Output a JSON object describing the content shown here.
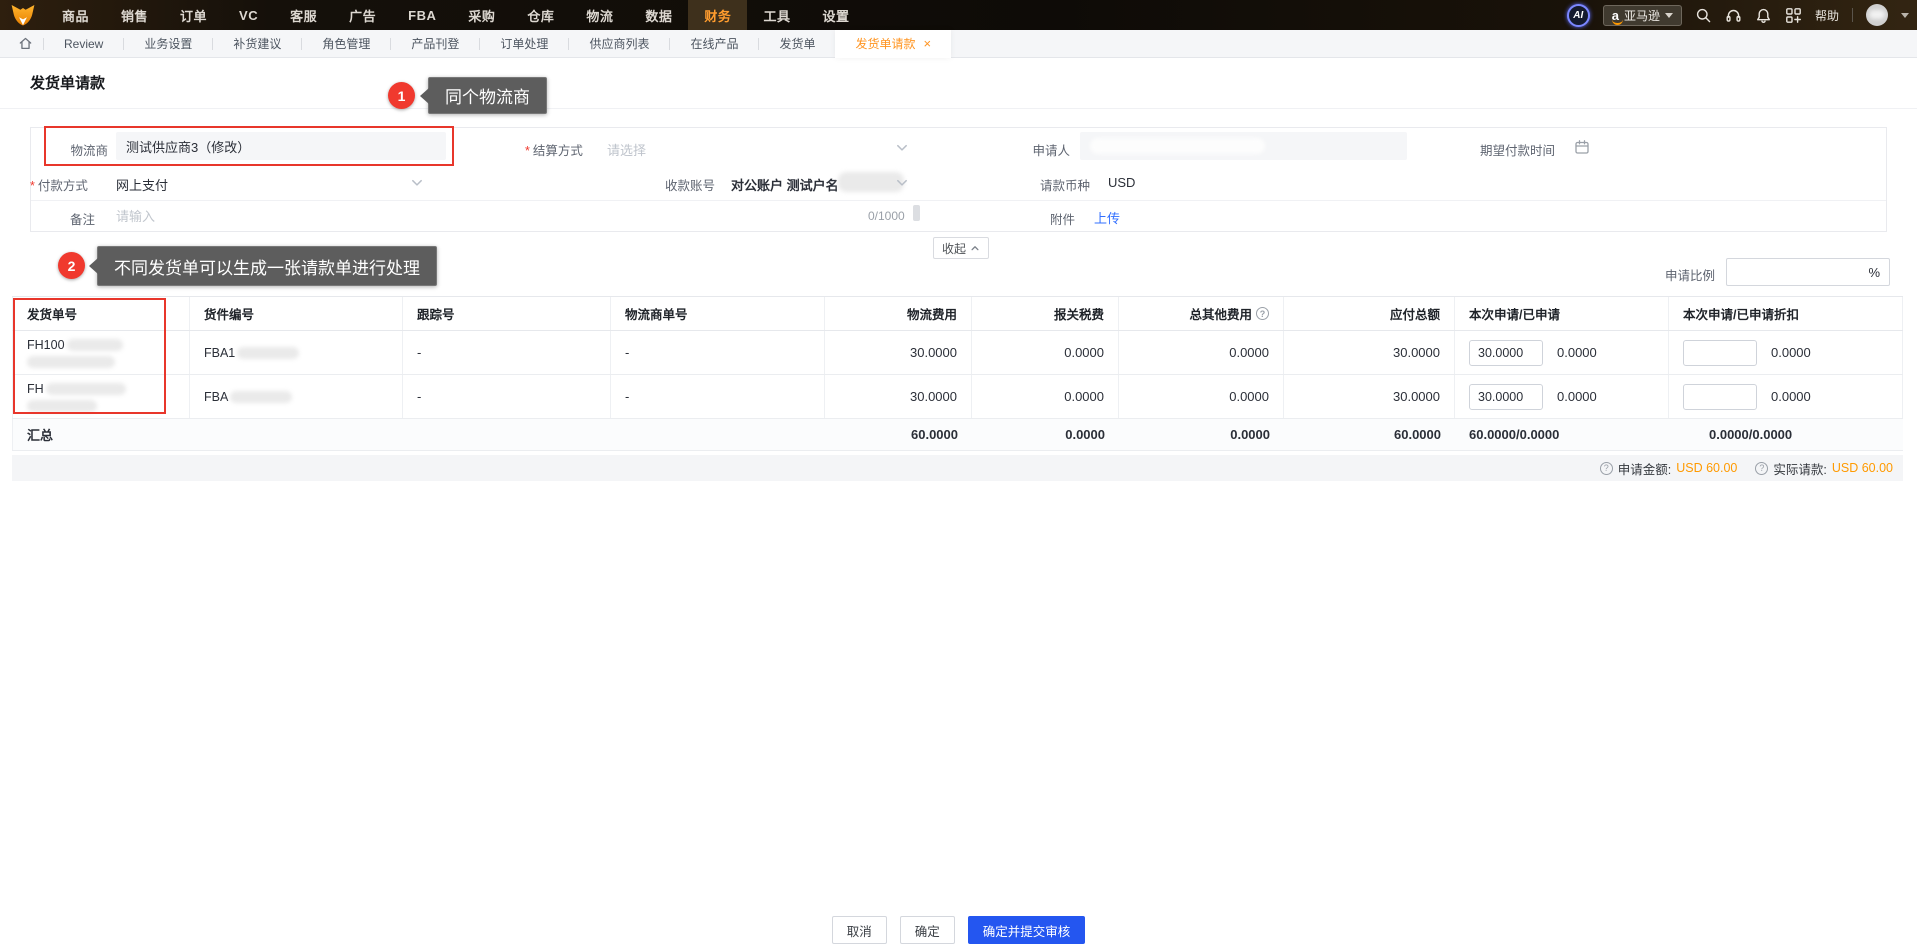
{
  "navbar": {
    "menu": [
      "商品",
      "销售",
      "订单",
      "VC",
      "客服",
      "广告",
      "FBA",
      "采购",
      "仓库",
      "物流",
      "数据",
      "财务",
      "工具",
      "设置"
    ],
    "active_menu": "财务",
    "ai_badge": "AI",
    "marketplace": "亚马逊",
    "amazon_glyph": "a",
    "help": "帮助"
  },
  "tabbar": {
    "tabs": [
      "Review",
      "业务设置",
      "补货建议",
      "角色管理",
      "产品刊登",
      "订单处理",
      "供应商列表",
      "在线产品",
      "发货单"
    ],
    "active_tab": "发货单请款",
    "close_glyph": "×"
  },
  "page": {
    "title": "发货单请款"
  },
  "annotations": {
    "first": {
      "badge": "1",
      "text": "同个物流商"
    },
    "second": {
      "badge": "2",
      "text": "不同发货单可以生成一张请款单进行处理"
    }
  },
  "form": {
    "logistics_label": "物流商",
    "logistics_value": "测试供应商3（修改）",
    "settlement_label": "结算方式",
    "settlement_placeholder": "请选择",
    "applicant_label": "申请人",
    "expect_date_label": "期望付款时间",
    "pay_method_label": "付款方式",
    "pay_method_value": "网上支付",
    "account_label": "收款账号",
    "account_value": "对公账户 测试户名",
    "currency_label": "请款币种",
    "currency_value": "USD",
    "remark_label": "备注",
    "remark_placeholder": "请输入",
    "remark_counter": "0/1000",
    "attachment_label": "附件",
    "upload_label": "上传",
    "collapse_label": "收起",
    "ratio_label": "申请比例",
    "ratio_suffix": "%",
    "required_mark": "*"
  },
  "table": {
    "headers": [
      "发货单号",
      "货件编号",
      "跟踪号",
      "物流商单号",
      "物流费用",
      "报关税费",
      "总其他费用",
      "应付总额",
      "本次申请/已申请",
      "本次申请/已申请折扣"
    ],
    "rows": [
      {
        "order_prefix": "FH100",
        "shipment_prefix": "FBA1",
        "tracking": "-",
        "carrier_no": "-",
        "freight": "30.0000",
        "tax": "0.0000",
        "other": "0.0000",
        "payable": "30.0000",
        "apply_value": "30.0000",
        "applied": "0.0000",
        "discount_applied": "0.0000"
      },
      {
        "order_prefix": "FH",
        "shipment_prefix": "FBA",
        "tracking": "-",
        "carrier_no": "-",
        "freight": "30.0000",
        "tax": "0.0000",
        "other": "0.0000",
        "payable": "30.0000",
        "apply_value": "30.0000",
        "applied": "0.0000",
        "discount_applied": "0.0000"
      }
    ],
    "summary": {
      "label": "汇总",
      "freight": "60.0000",
      "tax": "0.0000",
      "other": "0.0000",
      "payable": "60.0000",
      "apply": "60.0000/0.0000",
      "discount": "0.0000/0.0000"
    },
    "totals": {
      "help_glyph": "?",
      "apply_label": "申请金额:",
      "apply_value": "USD 60.00",
      "actual_label": "实际请款:",
      "actual_value": "USD 60.00"
    }
  },
  "actions": {
    "cancel": "取消",
    "confirm": "确定",
    "submit": "确定并提交审核"
  },
  "colors": {
    "accent_orange": "#ff9a00",
    "primary_blue": "#2456f0",
    "annotation_red": "#f0392e",
    "link_blue": "#3370ff",
    "nav_active_orange": "#ff9c2e"
  }
}
